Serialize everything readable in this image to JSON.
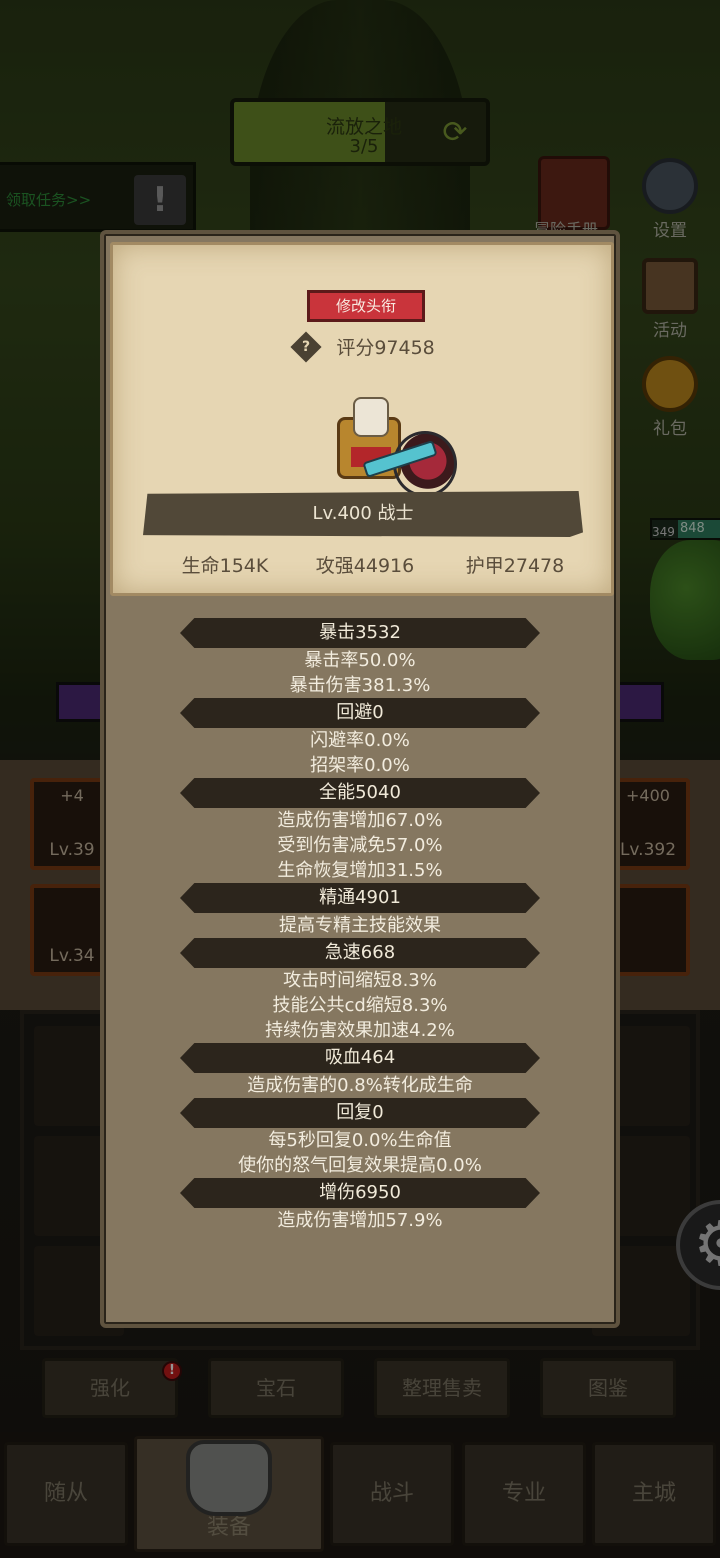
{
  "background": {
    "zone": {
      "name": "流放之地",
      "progress": "3/5",
      "fill_fraction": 0.6
    },
    "task_label": "领取任务>>",
    "side_menu": [
      {
        "label": "冒险手册",
        "icon": "book-icon"
      },
      {
        "label": "设置",
        "icon": "gear-icon"
      },
      {
        "label": "活动",
        "icon": "calendar-icon"
      },
      {
        "label": "礼包",
        "icon": "gift-icon"
      }
    ],
    "monster": {
      "level": "349",
      "hp_text": "848"
    },
    "equipment_slots": [
      {
        "plus": "+4",
        "level": "Lv.39"
      },
      {
        "plus": "",
        "level": "Lv.34"
      },
      {
        "plus": "+400",
        "level": "Lv.392"
      },
      {
        "plus": "",
        "level": ""
      }
    ],
    "func_buttons": [
      "强化",
      "宝石",
      "整理售卖",
      "图鉴"
    ],
    "func_badge": "!",
    "tabs": [
      "随从",
      "装备",
      "战斗",
      "专业",
      "主城"
    ],
    "active_tab": "装备"
  },
  "popup": {
    "title_button": "修改头衔",
    "help_glyph": "?",
    "score": "评分97458",
    "level_class": "Lv.400 战士",
    "base_stats": [
      "生命154K",
      "攻强44916",
      "护甲27478"
    ],
    "stat_groups": [
      {
        "header": "暴击3532",
        "lines": [
          "暴击率50.0%",
          "暴击伤害381.3%"
        ]
      },
      {
        "header": "回避0",
        "lines": [
          "闪避率0.0%",
          "招架率0.0%"
        ]
      },
      {
        "header": "全能5040",
        "lines": [
          "造成伤害增加67.0%",
          "受到伤害减免57.0%",
          "生命恢复增加31.5%"
        ]
      },
      {
        "header": "精通4901",
        "lines": [
          "提高专精主技能效果"
        ]
      },
      {
        "header": "急速668",
        "lines": [
          "攻击时间缩短8.3%",
          "技能公共cd缩短8.3%",
          "持续伤害效果加速4.2%"
        ]
      },
      {
        "header": "吸血464",
        "lines": [
          "造成伤害的0.8%转化成生命"
        ]
      },
      {
        "header": "回复0",
        "lines": [
          "每5秒回复0.0%生命值",
          "使你的怒气回复效果提高0.0%"
        ]
      },
      {
        "header": "增伤6950",
        "lines": [
          "造成伤害增加57.9%"
        ]
      }
    ]
  },
  "colors": {
    "popup_bg": "#857760",
    "paper": "#e6d6b3",
    "title_button": "#c9343b",
    "stat_band": "#2c251c"
  }
}
